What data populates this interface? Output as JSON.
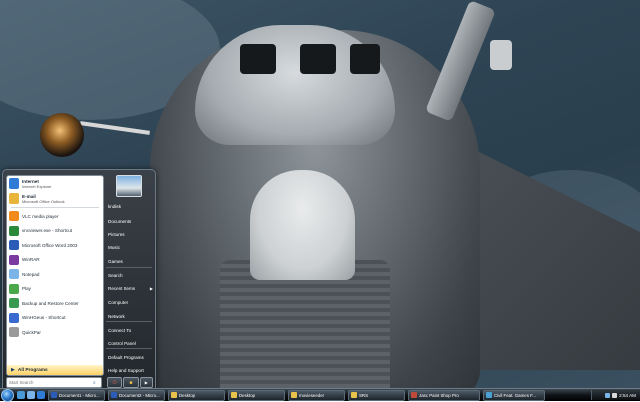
{
  "start_menu": {
    "pinned": [
      {
        "name": "pinned-internet",
        "label": "Internet",
        "sub": "Internet Explorer",
        "color": "#2f7bd6"
      },
      {
        "name": "pinned-email",
        "label": "E-mail",
        "sub": "Microsoft Office Outlook",
        "color": "#e8b53a"
      }
    ],
    "recent": [
      {
        "label": "VLC media player",
        "color": "#f08a1c"
      },
      {
        "label": "vncviewer.exe - Shortcut",
        "color": "#2a8a3a"
      },
      {
        "label": "Microsoft Office Word 2003",
        "color": "#2a5cb8"
      },
      {
        "label": "WinRAR",
        "color": "#7a3aa0"
      },
      {
        "label": "Notepad",
        "color": "#7db4e8"
      },
      {
        "label": "Play",
        "color": "#4aa84a"
      },
      {
        "label": "Backup and Restore Center",
        "color": "#3a9a52"
      },
      {
        "label": "WinHGeus - Shortcut",
        "color": "#3a6ad0"
      },
      {
        "label": "QuickPar",
        "color": "#9a9a9a"
      }
    ],
    "all_programs": "All Programs",
    "search_placeholder": "Start Search",
    "right_items": [
      {
        "name": "right-item-user",
        "label": "kndisk"
      },
      {
        "name": "right-item-documents",
        "label": "Documents"
      },
      {
        "name": "right-item-pictures",
        "label": "Pictures"
      },
      {
        "name": "right-item-music",
        "label": "Music"
      },
      {
        "name": "right-item-games",
        "label": "Games"
      },
      {
        "name": "right-item-search",
        "label": "Search"
      },
      {
        "name": "right-item-recent-items",
        "label": "Recent Items"
      },
      {
        "name": "right-item-computer",
        "label": "Computer"
      },
      {
        "name": "right-item-network",
        "label": "Network"
      },
      {
        "name": "right-item-connect-to",
        "label": "Connect To"
      },
      {
        "name": "right-item-control-panel",
        "label": "Control Panel"
      },
      {
        "name": "right-item-default-programs",
        "label": "Default Programs"
      },
      {
        "name": "right-item-help-and-support",
        "label": "Help and Support"
      }
    ]
  },
  "taskbar": {
    "tasks": [
      {
        "label": "Document1 - Micro...",
        "color": "#2a5cb8"
      },
      {
        "label": "Document2 - Micro...",
        "color": "#2a5cb8"
      },
      {
        "label": "Desktop",
        "color": "#e8c24a"
      },
      {
        "label": "Desktop",
        "color": "#e8c24a"
      },
      {
        "label": "movieseeder",
        "color": "#e8c24a"
      },
      {
        "label": "SRS",
        "color": "#e8c24a"
      },
      {
        "label": "Jasc Paint Shop Pro",
        "color": "#c04a3a"
      },
      {
        "label": "Civil Feat. Games F...",
        "color": "#4aa0d0"
      }
    ],
    "clock": "2:54 AM"
  }
}
